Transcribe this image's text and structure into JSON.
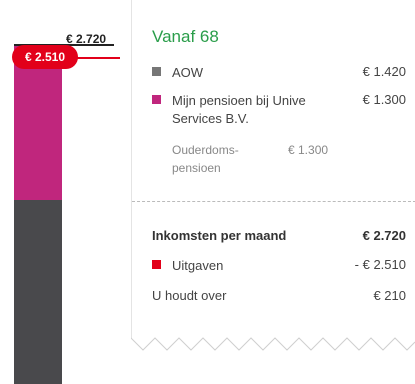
{
  "colors": {
    "aow": "#767676",
    "pension": "#c0267d",
    "expense": "#e2001a",
    "accent": "#2a9d4a",
    "bar_bottom": "#49494c"
  },
  "bar": {
    "total_label": "€ 2.720",
    "expense_label": "€ 2.510"
  },
  "panel": {
    "title": "Vanaf 68",
    "items": [
      {
        "icon": "grey-square-icon",
        "label": "AOW",
        "value": "€ 1.420"
      },
      {
        "icon": "magenta-square-icon",
        "label_lines": [
          "Mijn pensioen bij Unive",
          "Services B.V."
        ],
        "value": "€ 1.300"
      }
    ],
    "sub_item": {
      "label_lines": [
        "Ouderdoms-",
        "pensioen"
      ],
      "value": "€ 1.300"
    },
    "summary": {
      "income_label": "Inkomsten per maand",
      "income_value": "€ 2.720",
      "expense_label": "Uitgaven",
      "expense_value": "- € 2.510",
      "remaining_label": "U houdt over",
      "remaining_value": "€ 210"
    }
  }
}
